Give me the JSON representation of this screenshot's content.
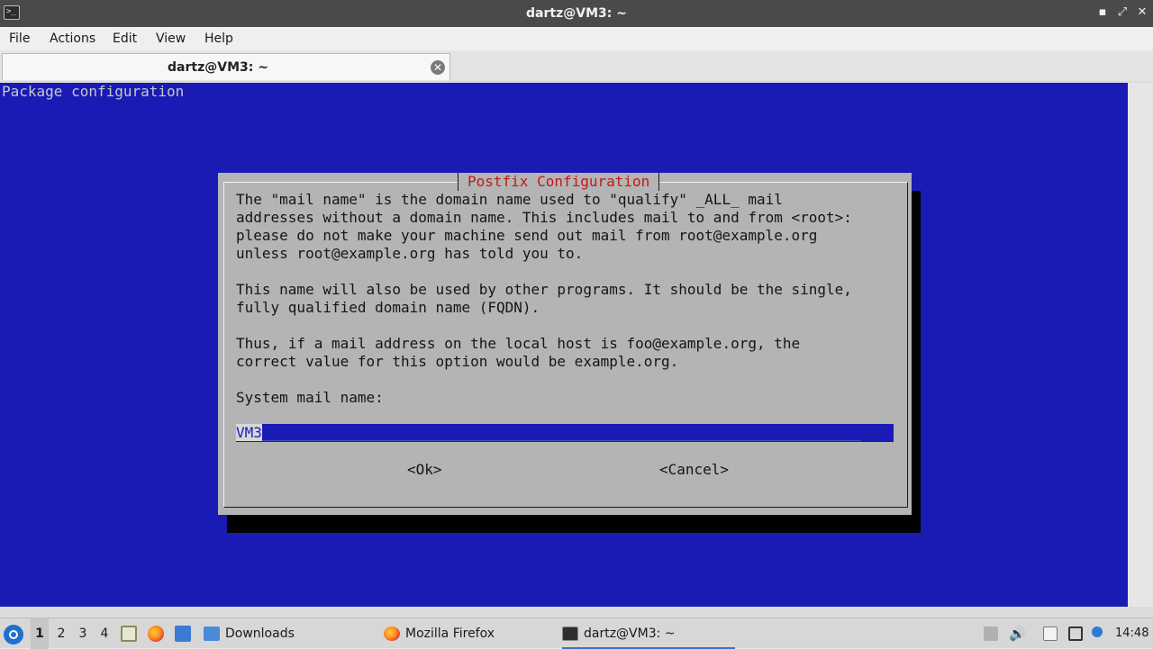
{
  "window": {
    "title": "dartz@VM3: ~",
    "minimize_glyph": "▪",
    "maximize_glyph": "⤢",
    "close_glyph": "✕"
  },
  "menu": {
    "items": [
      "File",
      "Actions",
      "Edit",
      "View",
      "Help"
    ]
  },
  "tab": {
    "title": "dartz@VM3: ~",
    "close_glyph": "✕"
  },
  "terminal": {
    "header": "Package configuration",
    "dialog": {
      "title": "Postfix Configuration",
      "lines": [
        "The \"mail name\" is the domain name used to \"qualify\" _ALL_ mail",
        "addresses without a domain name. This includes mail to and from <root>:",
        "please do not make your machine send out mail from root@example.org",
        "unless root@example.org has told you to.",
        "",
        "This name will also be used by other programs. It should be the single,",
        "fully qualified domain name (FQDN).",
        "",
        "Thus, if a mail address on the local host is foo@example.org, the",
        "correct value for this option would be example.org.",
        "",
        "System mail name:"
      ],
      "input_value": "VM3",
      "ok_label": "<Ok>",
      "cancel_label": "<Cancel>"
    }
  },
  "taskbar": {
    "desktops": [
      "1",
      "2",
      "3",
      "4"
    ],
    "active_desktop": "1",
    "tasks": [
      {
        "label": "Downloads",
        "icon": "folder-icon"
      },
      {
        "label": "Mozilla Firefox",
        "icon": "firefox-icon"
      },
      {
        "label": "dartz@VM3: ~",
        "icon": "terminal-icon"
      }
    ],
    "clock": "14:48"
  },
  "colors": {
    "terminal_bg": "#1a1ab4",
    "dialog_bg": "#b4b4b4",
    "dialog_title": "#c01818",
    "titlebar_bg": "#4a4a4a"
  }
}
